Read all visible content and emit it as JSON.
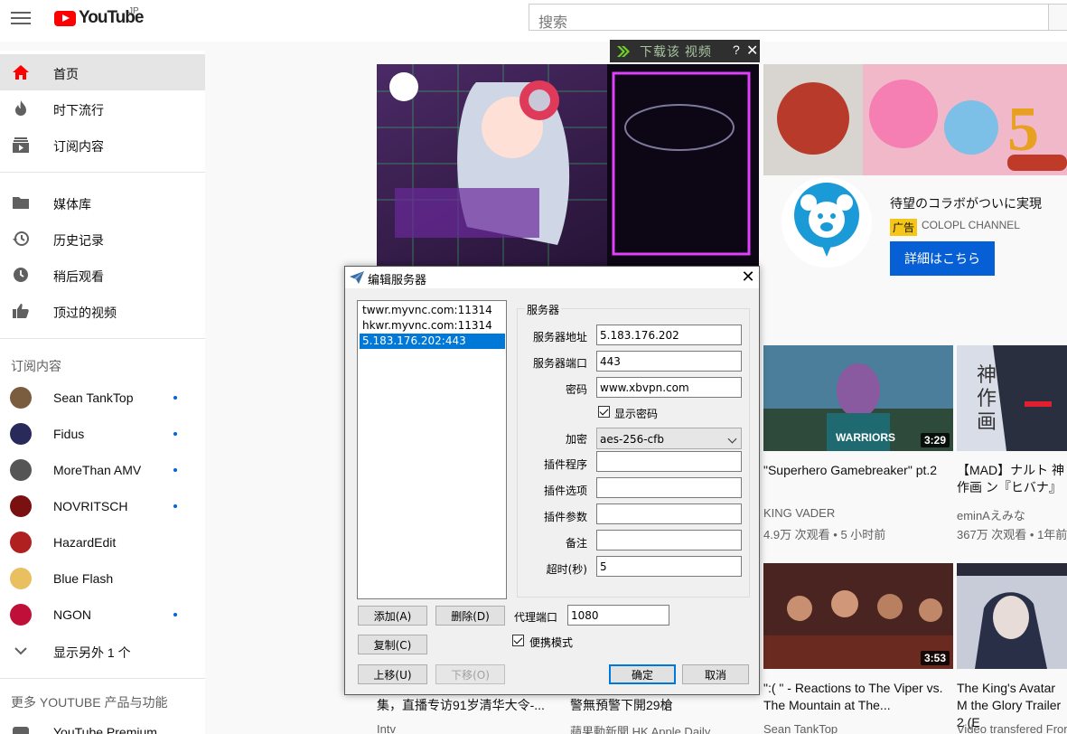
{
  "header": {
    "logo_text": "YouTube",
    "region": "JP",
    "search_placeholder": "搜索"
  },
  "sidebar": {
    "main": [
      {
        "label": "首页",
        "icon": "home-icon"
      },
      {
        "label": "时下流行",
        "icon": "fire-icon"
      },
      {
        "label": "订阅内容",
        "icon": "subscriptions-icon"
      }
    ],
    "library": [
      {
        "label": "媒体库",
        "icon": "folder-icon"
      },
      {
        "label": "历史记录",
        "icon": "history-icon"
      },
      {
        "label": "稍后观看",
        "icon": "clock-icon"
      },
      {
        "label": "顶过的视频",
        "icon": "thumbs-up-icon"
      }
    ],
    "subs_heading": "订阅内容",
    "subscriptions": [
      {
        "name": "Sean TankTop",
        "color": "#7a5c3e"
      },
      {
        "name": "Fidus",
        "color": "#2a2a5a"
      },
      {
        "name": "MoreThan AMV",
        "color": "#555"
      },
      {
        "name": "NOVRITSCH",
        "color": "#7a1010"
      },
      {
        "name": "HazardEdit",
        "color": "#b02020"
      },
      {
        "name": "Blue Flash",
        "color": "#e8c060"
      },
      {
        "name": "NGON",
        "color": "#c0103a"
      }
    ],
    "show_more": "显示另外 1 个",
    "more_heading": "更多 YOUTUBE 产品与功能",
    "premium": "YouTube Premium"
  },
  "download_bar": {
    "label": "下载该 视频",
    "help": "?",
    "close": "✕"
  },
  "ad": {
    "title": "待望のコラボがついに実現",
    "badge": "广告",
    "channel": "COLOPL CHANNEL",
    "button": "詳細はこちら"
  },
  "videos": [
    {
      "title": "\"Superhero Gamebreaker\" pt.2",
      "channel": "KING VADER",
      "meta": "4.9万 次观看 • 5 小时前",
      "duration": "3:29"
    },
    {
      "title": "【MAD】ナルト 神作画 ン『ヒバナ』",
      "channel": "eminAえみな",
      "meta": "367万 次观看 • 1年前",
      "duration": ""
    },
    {
      "title": "\":( \" - Reactions to The Viper vs. The Mountain at The...",
      "channel": "Sean TankTop",
      "meta": "",
      "duration": "3:53"
    },
    {
      "title": "The King's Avatar M the Glory Trailer 2 (E",
      "channel": "Video transfered From",
      "meta": "",
      "duration": ""
    }
  ],
  "bottom_row": [
    {
      "title": "集，直播专访91岁清华大令-...",
      "channel": "Intv"
    },
    {
      "title": "警無預警下開29槍",
      "channel": "蘋果動新聞 HK Apple Daily"
    }
  ],
  "dialog": {
    "title": "编辑服务器",
    "servers": [
      "twwr.myvnc.com:11314",
      "hkwr.myvnc.com:11314",
      "5.183.176.202:443"
    ],
    "selected_index": 2,
    "group_label": "服务器",
    "fields": {
      "address_label": "服务器地址",
      "address": "5.183.176.202",
      "port_label": "服务器端口",
      "port": "443",
      "password_label": "密码",
      "password": "www.xbvpn.com",
      "show_password": "显示密码",
      "encryption_label": "加密",
      "encryption": "aes-256-cfb",
      "plugin_label": "插件程序",
      "plugin": "",
      "plugin_opts_label": "插件选项",
      "plugin_opts": "",
      "plugin_args_label": "插件参数",
      "plugin_args": "",
      "remark_label": "备注",
      "remark": "",
      "timeout_label": "超时(秒)",
      "timeout": "5"
    },
    "proxy_port_label": "代理端口",
    "proxy_port": "1080",
    "portable_mode": "便携模式",
    "buttons": {
      "add": "添加(A)",
      "delete": "删除(D)",
      "copy": "复制(C)",
      "move_up": "上移(U)",
      "move_down": "下移(O)",
      "ok": "确定",
      "cancel": "取消"
    }
  }
}
